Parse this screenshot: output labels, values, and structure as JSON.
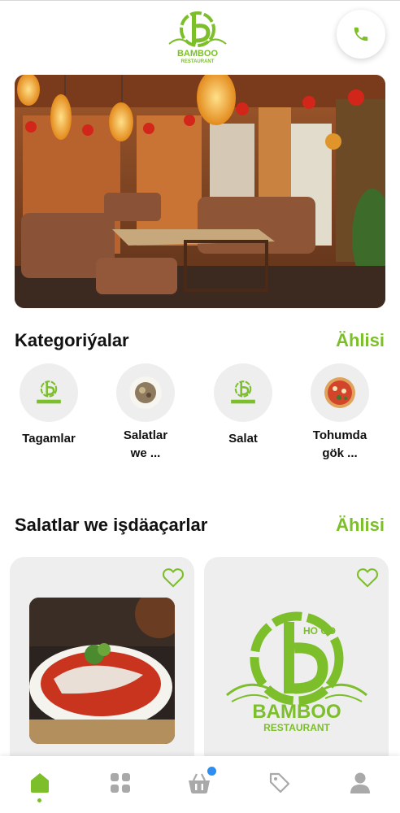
{
  "brand": {
    "name": "BAMBOO",
    "subtitle": "RESTAURANT",
    "mark_text": "HO GO",
    "accent_color": "#7cbf2a"
  },
  "header": {
    "call_icon": "phone-icon"
  },
  "categories_section": {
    "title": "Kategoriýalar",
    "see_all": "Ählisi",
    "items": [
      {
        "label": "Tagamlar"
      },
      {
        "label": "Salatlar\nwe ..."
      },
      {
        "label": "Salat"
      },
      {
        "label": "Tohumda\ngök ..."
      }
    ]
  },
  "products_section": {
    "title": "Salatlar we işdäaçarlar",
    "see_all": "Ählisi"
  },
  "bottom_nav": {
    "items": [
      {
        "icon": "home-icon",
        "active": true
      },
      {
        "icon": "grid-icon",
        "active": false
      },
      {
        "icon": "basket-icon",
        "active": false,
        "badge": true
      },
      {
        "icon": "tag-icon",
        "active": false
      },
      {
        "icon": "user-icon",
        "active": false
      }
    ]
  }
}
